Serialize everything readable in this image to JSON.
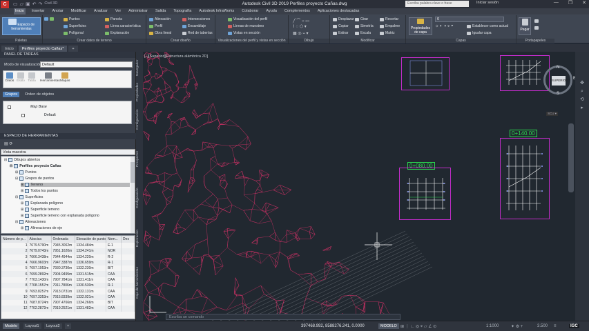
{
  "app": {
    "title": "Autodesk Civil 3D 2019    Perfiles proyecto Cañas.dwg",
    "workspace": "Civil 3D",
    "search_placeholder": "Escriba palabra clave o frase",
    "signin": "Iniciar sesión",
    "window_controls": [
      "—",
      "❐",
      "✕"
    ]
  },
  "ribbon_tabs": [
    "Inicio",
    "Insertar",
    "Anotar",
    "Modificar",
    "Analizar",
    "Ver",
    "Administrar",
    "Salida",
    "Topografía",
    "Autodesk InfraWorks",
    "Colaborar",
    "Ayuda",
    "Complementos",
    "Aplicaciones destacadas"
  ],
  "ribbon": {
    "palettes": {
      "big": "Espacio de herramientas",
      "title": "Paletas"
    },
    "ground": {
      "items": [
        "Puntos",
        "Superficies",
        "Polígonal",
        "Parcela",
        "Línea característica",
        "Explanación"
      ],
      "title": "Crear datos de terreno"
    },
    "design": {
      "items": [
        "Alineación",
        "Perfil",
        "Obra lineal",
        "Intersecciones",
        "Ensamblaje",
        "Red de tuberías"
      ],
      "title": "Crear diseño"
    },
    "profile": {
      "items": [
        "Visualización del perfil",
        "Líneas de muestreo",
        "Vistas en sección"
      ],
      "title": "Visualizaciones del perfil y vistas en sección"
    },
    "draw": {
      "title": "Dibujo"
    },
    "modify": {
      "items": [
        "Desplazar",
        "Copiar",
        "Estirar",
        "Girar",
        "Simetría",
        "Escala",
        "Recortar",
        "Empalme",
        "Matriz"
      ],
      "title": "Modificar"
    },
    "layers": {
      "big": "Propiedades de capa",
      "layer_value": "0",
      "items": [
        "Establecer como actual",
        "Igualar capa"
      ],
      "title": "Capas"
    },
    "clipboard": {
      "big": "Pegar",
      "title": "Portapapeles"
    }
  },
  "doc_tabs": [
    "Inicio",
    "Perfiles proyecto Cañas*"
  ],
  "toolspace_top": {
    "header": "PANEL DE TAREAS",
    "mode_label": "Modo de visualización:",
    "mode_value": "Default",
    "tools": [
      "Datos",
      "Estilo",
      "Tabla",
      "Herramientas",
      "Mapas"
    ],
    "subtabs": [
      "Grupos",
      "Orden de objetos"
    ],
    "map_base": "Map Base",
    "default_item": "Default"
  },
  "toolspace": {
    "header": "ESPACIO DE HERRAMIENTAS",
    "view_select": "Vista maestra",
    "tree": [
      {
        "label": "Dibujos abiertos",
        "level": 0
      },
      {
        "label": "Perfiles proyecto Cañas",
        "level": 1,
        "bold": true
      },
      {
        "label": "Puntos",
        "level": 2
      },
      {
        "label": "Grupos de puntos",
        "level": 2
      },
      {
        "label": "Terreno",
        "level": 3,
        "selected": true
      },
      {
        "label": "Todos los puntos",
        "level": 3
      },
      {
        "label": "Superficies",
        "level": 2
      },
      {
        "label": "Explanada polígono",
        "level": 3
      },
      {
        "label": "Superficie terreno",
        "level": 3
      },
      {
        "label": "Superficie terreno con explanada polígono",
        "level": 3
      },
      {
        "label": "Alineaciones",
        "level": 2
      },
      {
        "label": "Alineaciones de eje",
        "level": 3
      }
    ]
  },
  "point_table": {
    "columns": [
      "Número de p...",
      "Abscisa",
      "Ordenada",
      "Elevación de punto",
      "Nom...",
      "Des"
    ],
    "rows": [
      [
        "1",
        "7679.5790m",
        "7945.3062m",
        "1334.484m",
        "E-1"
      ],
      [
        "2",
        "7679.0743m",
        "7951.1620m",
        "1334.241m",
        "NOR"
      ],
      [
        "3",
        "7666.3438m",
        "7944.4944m",
        "1334.220m",
        "R-2"
      ],
      [
        "4",
        "7666.9603m",
        "7947.3387m",
        "1336.659m",
        "R-1"
      ],
      [
        "5",
        "7697.1953m",
        "7930.3730m",
        "1332.230m",
        "BIT"
      ],
      [
        "6",
        "7699.2892m",
        "7904.9495m",
        "1331.515m",
        "CAA"
      ],
      [
        "7",
        "7703.1430m",
        "7907.7841m",
        "1331.411m",
        "CAA"
      ],
      [
        "8",
        "7708.1557m",
        "7911.7806m",
        "1330.530m",
        "R-1"
      ],
      [
        "9",
        "7693.8257m",
        "7913.0731m",
        "1332.131m",
        "CAA"
      ],
      [
        "10",
        "7697.3353m",
        "7915.8339m",
        "1332.021m",
        "CAA"
      ],
      [
        "11",
        "7687.8724m",
        "7907.4766m",
        "1334.266m",
        "BIT"
      ],
      [
        "12",
        "7702.2872m",
        "7919.2521m",
        "1331.482m",
        "CAA"
      ]
    ]
  },
  "side_strip": [
    "Navegador",
    "Propiedades",
    "Configuración",
    "Exploración",
    "Caja de herramientas"
  ],
  "side_strip_top": [
    "Prospector",
    "Configuración",
    "Topografía"
  ],
  "canvas": {
    "viewport_label": "[–][Superior][Estructura alámbrica 2D]",
    "station_1": "0+080.00",
    "station_2": "0+140.00",
    "viewcube_face": "SUPERIOR",
    "compass": {
      "n": "N",
      "e": "E",
      "s": "S"
    },
    "wcs": "SCU ▾"
  },
  "command_placeholder": "Escriba un comando",
  "status": {
    "tabs": [
      "Modelo",
      "Layout1",
      "Layout2"
    ],
    "coords": "397468.992, 8588276.241, 0.0000",
    "mode": "MODELO",
    "scale": "1:1000",
    "value": "3.500"
  },
  "colors": {
    "canvas": "#212830",
    "tin": "#e0326b",
    "profile_box": "#c02cc8",
    "station": "#2ad94f",
    "grid": "#8fa0ff"
  }
}
